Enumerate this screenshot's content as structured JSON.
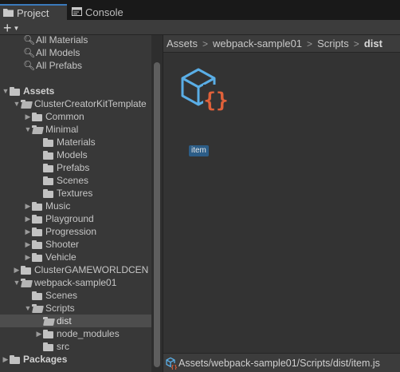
{
  "tabs": [
    {
      "label": "Project",
      "icon": "folder-icon",
      "active": true
    },
    {
      "label": "Console",
      "icon": "console-icon",
      "active": false
    }
  ],
  "toolbar": {
    "add_label": "+",
    "add_icon": "plus-icon"
  },
  "favorites": [
    {
      "label": "All Materials",
      "icon": "search-icon"
    },
    {
      "label": "All Models",
      "icon": "search-icon"
    },
    {
      "label": "All Prefabs",
      "icon": "search-icon"
    }
  ],
  "tree": [
    {
      "label": "Assets",
      "expanded": true,
      "bold": true
    },
    {
      "label": "ClusterCreatorKitTemplate",
      "expanded": true
    },
    {
      "label": "Common",
      "expanded": false
    },
    {
      "label": "Minimal",
      "expanded": true
    },
    {
      "label": "Materials"
    },
    {
      "label": "Models"
    },
    {
      "label": "Prefabs"
    },
    {
      "label": "Scenes"
    },
    {
      "label": "Textures"
    },
    {
      "label": "Music",
      "expanded": false
    },
    {
      "label": "Playground",
      "expanded": false
    },
    {
      "label": "Progression",
      "expanded": false
    },
    {
      "label": "Shooter",
      "expanded": false
    },
    {
      "label": "Vehicle",
      "expanded": false
    },
    {
      "label": "ClusterGAMEWORLDCEN",
      "expanded": false
    },
    {
      "label": "webpack-sample01",
      "expanded": true
    },
    {
      "label": "Scenes"
    },
    {
      "label": "Scripts",
      "expanded": true
    },
    {
      "label": "dist",
      "selected": true
    },
    {
      "label": "node_modules",
      "expanded": false
    },
    {
      "label": "src"
    },
    {
      "label": "Packages",
      "expanded": false,
      "bold": true
    }
  ],
  "breadcrumb": [
    "Assets",
    "webpack-sample01",
    "Scripts",
    "dist"
  ],
  "assets": [
    {
      "label": "item",
      "icon": "js-script-icon",
      "selected": true
    }
  ],
  "status": {
    "path": "Assets/webpack-sample01/Scripts/dist/item.js",
    "icon": "script-file-icon"
  },
  "colors": {
    "accent": "#3a79bb",
    "cube": "#5aaee6",
    "braces": "#e0613a",
    "selection": "#2c5d87"
  }
}
